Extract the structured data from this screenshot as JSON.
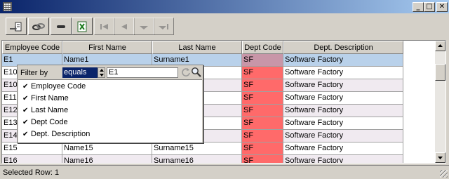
{
  "window": {
    "title": "",
    "minimize_label": "_",
    "maximize_label": "□",
    "close_label": "✕"
  },
  "toolbar": {
    "buttons": [
      {
        "icon": "export-icon",
        "enabled": true
      },
      {
        "icon": "link-icon",
        "enabled": true
      },
      {
        "icon": "remove-icon",
        "enabled": true
      },
      {
        "icon": "excel-icon",
        "enabled": true
      },
      {
        "icon": "first-record-icon",
        "enabled": false
      },
      {
        "icon": "previous-record-icon",
        "enabled": false
      },
      {
        "icon": "next-record-icon",
        "enabled": false
      },
      {
        "icon": "last-record-icon",
        "enabled": false
      }
    ]
  },
  "grid": {
    "columns": [
      "Employee Code",
      "First Name",
      "Last Name",
      "Dept Code",
      "Dept. Description"
    ],
    "rows": [
      [
        "E1",
        "Name1",
        "Surname1",
        "SF",
        "Software Factory"
      ],
      [
        "E10",
        "",
        "",
        "SF",
        "Software Factory"
      ],
      [
        "E100",
        "",
        "",
        "SF",
        "Software Factory"
      ],
      [
        "E11",
        "",
        "",
        "SF",
        "Software Factory"
      ],
      [
        "E12",
        "",
        "",
        "SF",
        "Software Factory"
      ],
      [
        "E13",
        "",
        "",
        "SF",
        "Software Factory"
      ],
      [
        "E14",
        "",
        "",
        "SF",
        "Software Factory"
      ],
      [
        "E15",
        "Name15",
        "Surname15",
        "SF",
        "Software Factory"
      ],
      [
        "E16",
        "Name16",
        "Surname16",
        "SF",
        "Software Factory"
      ]
    ],
    "selected_row": 0,
    "colors": {
      "row_even": "#f0eaf0",
      "row_selected": "#b9d1ea",
      "dept_highlight": "#ff6a6a"
    }
  },
  "filter_popup": {
    "label": "Filter by",
    "operator": "equals",
    "value": "E1",
    "columns": [
      {
        "label": "Employee Code",
        "checked": true
      },
      {
        "label": "First Name",
        "checked": true
      },
      {
        "label": "Last Name",
        "checked": true
      },
      {
        "label": "Dept Code",
        "checked": true
      },
      {
        "label": "Dept. Description",
        "checked": true
      }
    ],
    "check_glyph": "✔"
  },
  "status": {
    "text": "Selected Row: 1"
  }
}
